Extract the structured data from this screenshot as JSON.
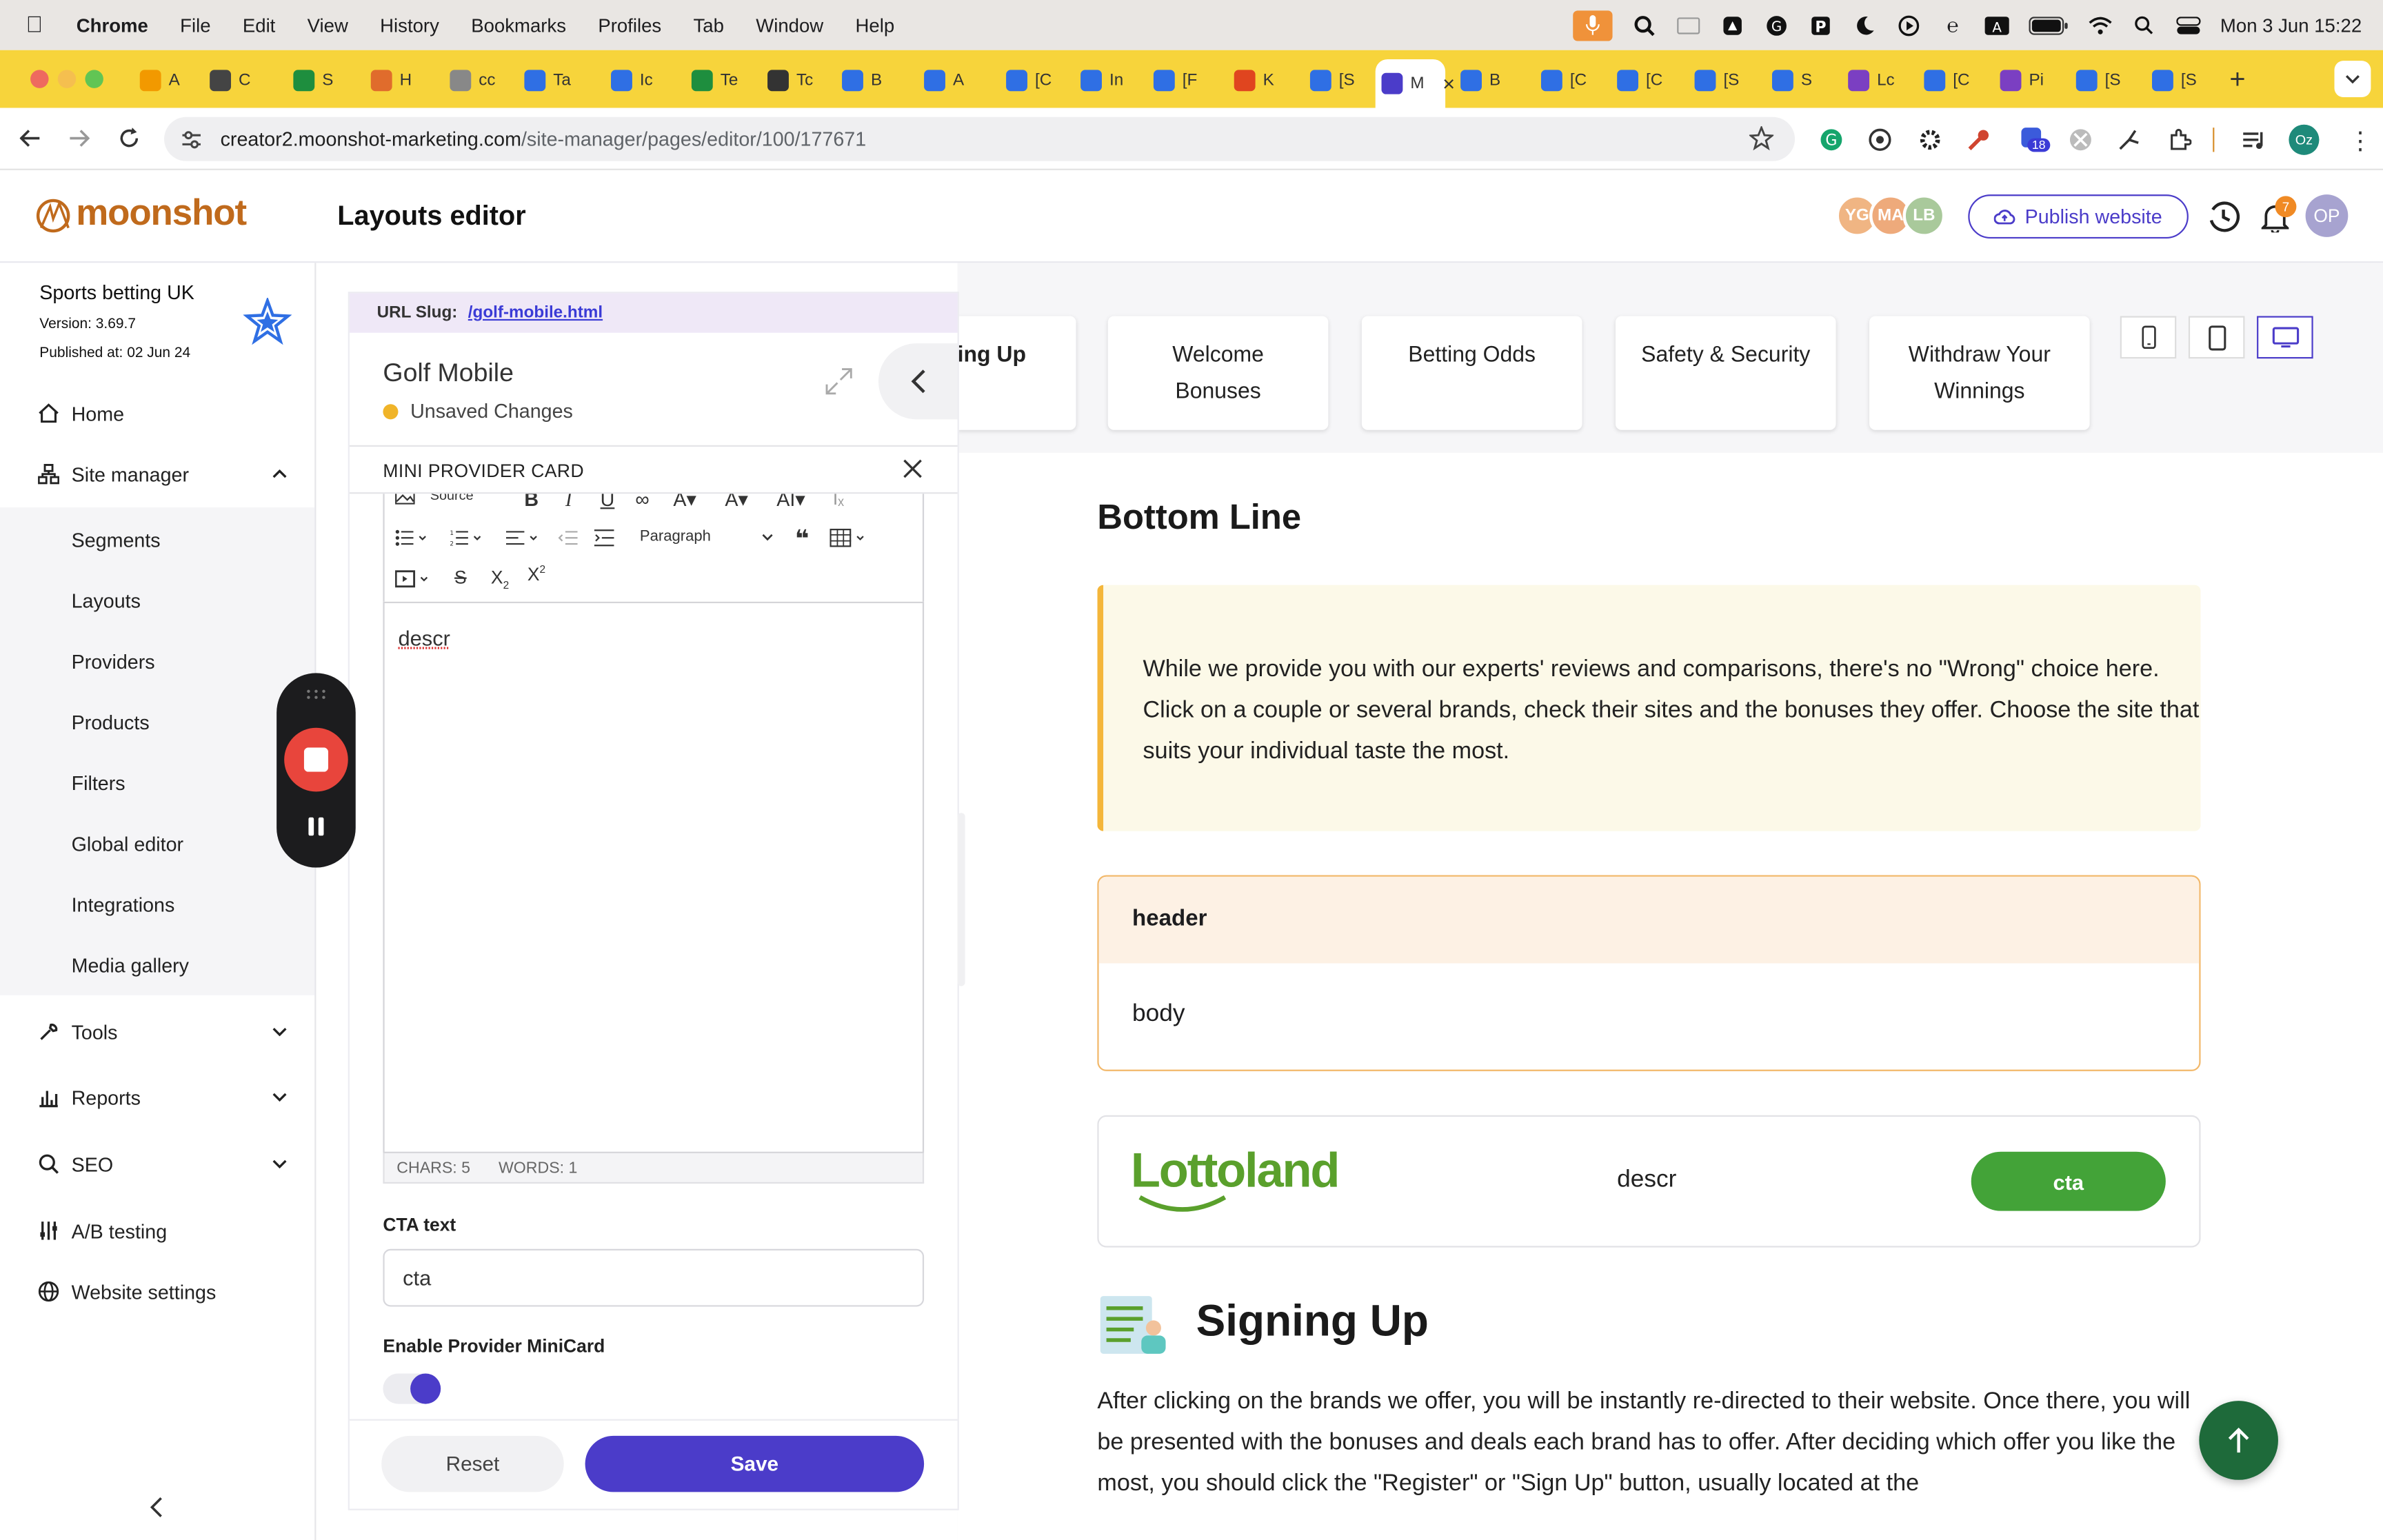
{
  "menubar": {
    "app": "Chrome",
    "items": [
      "File",
      "Edit",
      "View",
      "History",
      "Bookmarks",
      "Profiles",
      "Tab",
      "Window",
      "Help"
    ],
    "datetime": "Mon 3 Jun  15:22"
  },
  "tabs": [
    {
      "label": "A",
      "color": "#f29900"
    },
    {
      "label": "C",
      "color": "#444444"
    },
    {
      "label": "S",
      "color": "#1e8e3e"
    },
    {
      "label": "H",
      "color": "#e06c2c"
    },
    {
      "label": "cc",
      "color": "#888888"
    },
    {
      "label": "Ta",
      "color": "#2f6fe4"
    },
    {
      "label": "Ic",
      "color": "#2f6fe4"
    },
    {
      "label": "Te",
      "color": "#1e8e3e"
    },
    {
      "label": "Tc",
      "color": "#333333"
    },
    {
      "label": "B",
      "color": "#2f6fe4"
    },
    {
      "label": "A",
      "color": "#2f6fe4"
    },
    {
      "label": "[C",
      "color": "#2f6fe4"
    },
    {
      "label": "In",
      "color": "#2f6fe4"
    },
    {
      "label": "[F",
      "color": "#2f6fe4"
    },
    {
      "label": "K",
      "color": "#e0451f"
    },
    {
      "label": "[S",
      "color": "#2f6fe4"
    },
    {
      "label": "M",
      "color": "#4b3cc9",
      "active": true
    },
    {
      "label": "B",
      "color": "#2f6fe4"
    },
    {
      "label": "[C",
      "color": "#2f6fe4"
    },
    {
      "label": "[C",
      "color": "#2f6fe4"
    },
    {
      "label": "[S",
      "color": "#2f6fe4"
    },
    {
      "label": "S",
      "color": "#2f6fe4"
    },
    {
      "label": "Lc",
      "color": "#7b3fc2"
    },
    {
      "label": "[C",
      "color": "#2f6fe4"
    },
    {
      "label": "Pi",
      "color": "#7b3fc2"
    },
    {
      "label": "[S",
      "color": "#2f6fe4"
    },
    {
      "label": "[S",
      "color": "#2f6fe4"
    }
  ],
  "address": {
    "host": "creator2.moonshot-marketing.com",
    "path": "/site-manager/pages/editor/100/177671"
  },
  "ext_badge": "18",
  "profile_initials": "Oz",
  "header": {
    "logo": "moonshot",
    "title": "Layouts editor",
    "avatars": [
      {
        "initials": "YG",
        "color": "#f0b583"
      },
      {
        "initials": "MA",
        "color": "#eeaa7b"
      },
      {
        "initials": "LB",
        "color": "#a9c99b"
      }
    ],
    "publish_label": "Publish website",
    "notifications_count": "7",
    "user_initials": "OP"
  },
  "site": {
    "name": "Sports betting UK",
    "version": "Version: 3.69.7",
    "published": "Published at: 02 Jun 24"
  },
  "sidebar": {
    "home": "Home",
    "site_manager": "Site manager",
    "sub_items": [
      "Segments",
      "Layouts",
      "Providers",
      "Products",
      "Filters",
      "Global editor",
      "Integrations",
      "Media gallery"
    ],
    "tools": "Tools",
    "reports": "Reports",
    "seo": "SEO",
    "ab_testing": "A/B testing",
    "website_settings": "Website settings"
  },
  "panel": {
    "slug_label": "URL Slug:",
    "slug_value": "/golf-mobile.html",
    "page_name": "Golf Mobile",
    "status": "Unsaved Changes",
    "section_title": "MINI PROVIDER CARD",
    "toolbar_source": "Source",
    "toolbar_paragraph": "Paragraph",
    "editor_text": "descr",
    "chars": "CHARS: 5",
    "words": "WORDS: 1",
    "cta_label": "CTA text",
    "cta_value": "cta",
    "toggle_label": "Enable Provider MiniCard",
    "toggle_on": true,
    "reset_label": "Reset",
    "save_label": "Save"
  },
  "preview": {
    "nav_cards": [
      {
        "line1": "ing Up",
        "line2": ""
      },
      {
        "line1": "Welcome",
        "line2": "Bonuses"
      },
      {
        "line1": "Betting Odds",
        "line2": ""
      },
      {
        "line1": "Safety & Security",
        "line2": ""
      },
      {
        "line1": "Withdraw Your",
        "line2": "Winnings"
      }
    ],
    "bottom_line_title": "Bottom Line",
    "callout_text": "While we provide you with our experts' reviews and comparisons, there's no \"Wrong\" choice here. Click on a couple or several brands, check their sites and the bonuses they offer. Choose the site that suits your individual taste the most.",
    "accordion_header": "header",
    "accordion_body": "body",
    "minicard_brand": "Lottoland",
    "minicard_desc": "descr",
    "minicard_cta": "cta",
    "signing_title": "Signing Up",
    "signing_body": "After clicking on the brands we offer, you will be instantly re-directed to their website. Once there, you will be presented with the bonuses and deals each brand has to offer. After deciding which offer you like the most, you should click the \"Register\" or \"Sign Up\" button, usually located at the"
  },
  "colors": {
    "accent": "#4b3cc9",
    "tabstrip": "#f7d43b",
    "cta_green": "#43a338",
    "lottoland_green": "#5aa02c",
    "unsaved_dot": "#f0b429"
  }
}
